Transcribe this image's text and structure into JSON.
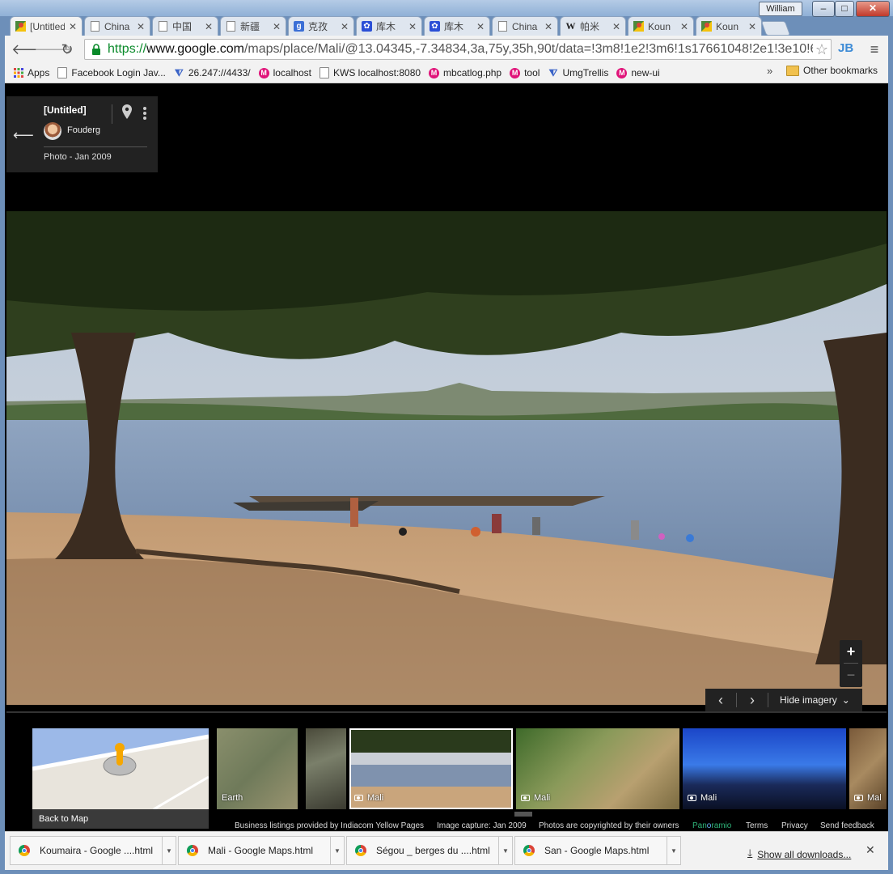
{
  "window": {
    "user": "William",
    "minimize": "–",
    "maximize": "□",
    "close": "✕"
  },
  "tabs": [
    {
      "label": "[Untitled]",
      "icon": "google-maps-icon",
      "active": true
    },
    {
      "label": "China",
      "icon": "page-icon"
    },
    {
      "label": "中国",
      "icon": "page-icon"
    },
    {
      "label": "新疆",
      "icon": "page-icon"
    },
    {
      "label": "克孜",
      "icon": "google-icon"
    },
    {
      "label": "库木",
      "icon": "baidu-icon"
    },
    {
      "label": "库木",
      "icon": "baidu-icon"
    },
    {
      "label": "China",
      "icon": "page-icon"
    },
    {
      "label": "帕米",
      "icon": "wikipedia-icon"
    },
    {
      "label": "Koun",
      "icon": "google-maps-icon"
    },
    {
      "label": "Koun",
      "icon": "google-maps-icon"
    }
  ],
  "toolbar": {
    "url_scheme": "https://",
    "url_host": "www.google.com",
    "url_path": "/maps/place/Mali/@13.04345,-7.34834,3a,75y,35h,90t/data=!3m8!1e2!3m6!1s17661048!2e1!3e10!6",
    "star": "☆",
    "jb": "JB",
    "menu": "≡"
  },
  "bookmarks": {
    "items": [
      {
        "label": "Apps",
        "icon": "apps-grid-icon"
      },
      {
        "label": "Facebook Login Jav...",
        "icon": "page-icon"
      },
      {
        "label": "26.247://4433/",
        "icon": "visualstudio-icon"
      },
      {
        "label": "localhost",
        "icon": "magento-icon"
      },
      {
        "label": "KWS localhost:8080",
        "icon": "page-icon"
      },
      {
        "label": "mbcatlog.php",
        "icon": "magento-icon"
      },
      {
        "label": "tool",
        "icon": "magento-icon"
      },
      {
        "label": "UmgTrellis",
        "icon": "visualstudio-icon"
      },
      {
        "label": "new-ui",
        "icon": "magento-icon"
      }
    ],
    "more": "»",
    "other": "Other bookmarks"
  },
  "info_card": {
    "title": "[Untitled]",
    "author": "Fouderg",
    "date": "Photo - Jan 2009"
  },
  "controls": {
    "zoom_in": "+",
    "zoom_out": "−",
    "prev": "‹",
    "next": "›",
    "hide_imagery": "Hide imagery"
  },
  "filmstrip": {
    "back_to_map": "Back to Map",
    "thumbs": [
      {
        "label": "Earth",
        "camera": false
      },
      {
        "label": "",
        "camera": false
      },
      {
        "label": "Mali",
        "camera": true,
        "selected": true
      },
      {
        "label": "Mali",
        "camera": true
      },
      {
        "label": "Mali",
        "camera": true
      },
      {
        "label": "Mal",
        "camera": true
      }
    ]
  },
  "footer": {
    "listings": "Business listings provided by Indiacom Yellow Pages",
    "capture": "Image capture: Jan 2009",
    "copyright": "Photos are copyrighted by their owners",
    "panoramio_a": "Pan",
    "panoramio_b": "o",
    "panoramio_c": "ramio",
    "terms": "Terms",
    "privacy": "Privacy",
    "feedback": "Send feedback"
  },
  "downloads": {
    "items": [
      {
        "label": "Koumaira - Google ....html"
      },
      {
        "label": "Mali - Google Maps.html"
      },
      {
        "label": "Ségou _ berges du ....html"
      },
      {
        "label": "San - Google Maps.html"
      }
    ],
    "show_all": "Show all downloads...",
    "close": "✕"
  },
  "colors": {
    "accent_green": "#0a8a2a",
    "panoramio_green": "#2fb57a",
    "panoramio_blue": "#6cb5ff"
  }
}
